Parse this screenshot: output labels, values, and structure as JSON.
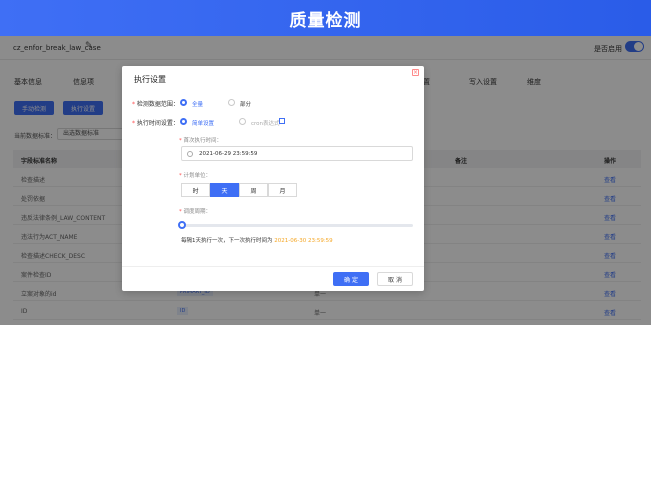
{
  "banner": {
    "title": "质量检测"
  },
  "topbar": {
    "name": "cz_enfor_break_law_case",
    "enable_label": "是否启用"
  },
  "tabs": [
    "基本信息",
    "信息项",
    "",
    "",
    "",
    "",
    "",
    "",
    "置",
    "写入设置",
    "维度"
  ],
  "toolbar": {
    "manual_check": "手动检测",
    "exec_settings": "执行设置"
  },
  "rules": {
    "label": "当前数据标准：",
    "value": "出选数据标准"
  },
  "table": {
    "headers": [
      "字段标准名称",
      "",
      "备注",
      "操作"
    ],
    "rows": [
      {
        "name": "检查描述",
        "tag": "",
        "remark": "",
        "action": "查看"
      },
      {
        "name": "处罚依据",
        "tag": "",
        "remark": "",
        "action": "查看"
      },
      {
        "name": "违反法律条例_LAW_CONTENT",
        "tag": "",
        "remark": "",
        "action": "查看"
      },
      {
        "name": "违法行为ACT_NAME",
        "tag": "",
        "remark": "",
        "action": "查看"
      },
      {
        "name": "检查描述CHECK_DESC",
        "tag": "",
        "remark": "",
        "action": "查看"
      },
      {
        "name": "案件检查ID",
        "tag": "",
        "remark": "",
        "action": "查看"
      },
      {
        "name": "立案对象的id",
        "tag": "PRIMARY_ID",
        "remark": "单一",
        "action": "查看"
      },
      {
        "name": "ID",
        "tag": "ID",
        "remark": "单一",
        "action": "查看"
      }
    ]
  },
  "modal": {
    "title": "执行设置",
    "scope_label": "检测数据范围：",
    "scope_options": [
      "全量",
      "部分"
    ],
    "time_label": "执行时间设置：",
    "time_options": [
      "简单设置",
      "cron表达式"
    ],
    "first_exec_label": "首次执行时间：",
    "first_exec_value": "2021-06-29 23:59:59",
    "unit_label": "计划单位：",
    "units": [
      "时",
      "天",
      "周",
      "月"
    ],
    "selected_unit": "天",
    "period_label": "调度周期：",
    "period_value": 0,
    "exec_text": "每隔1天执行一次，下一次执行时间为",
    "next_time": "2021-06-30 23:59:59",
    "ok": "确 定",
    "cancel": "取 消"
  }
}
